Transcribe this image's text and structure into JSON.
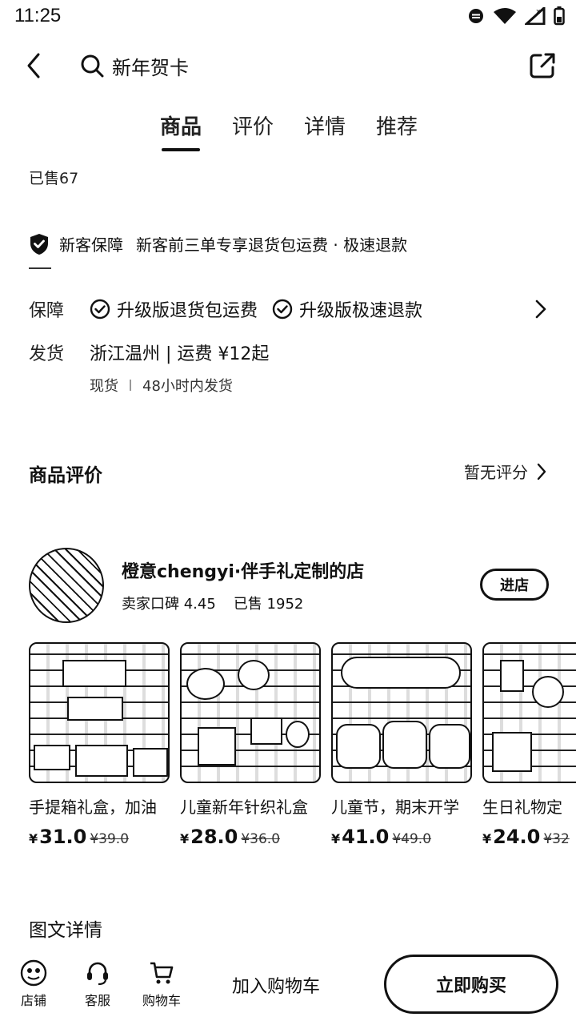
{
  "status": {
    "time": "11:25"
  },
  "header": {
    "search_text": "新年贺卡"
  },
  "tabs": [
    {
      "label": "商品"
    },
    {
      "label": "评价"
    },
    {
      "label": "详情"
    },
    {
      "label": "推荐"
    }
  ],
  "sold": "已售67",
  "guarantee": {
    "title": "新客保障",
    "desc": "新客前三单专享退货包运费 · 极速退款"
  },
  "service": {
    "label": "保障",
    "items": [
      "升级版退货包运费",
      "升级版极速退款"
    ]
  },
  "shipping": {
    "label": "发货",
    "text": "浙江温州 | 运费 ¥12起",
    "stock": "现货",
    "time": "48小时内发货"
  },
  "reviews": {
    "title": "商品评价",
    "status": "暂无评分"
  },
  "store": {
    "name": "橙意chengyi·伴手礼定制的店",
    "rating": "卖家口碑 4.45",
    "sold": "已售 1952",
    "enter": "进店"
  },
  "products": [
    {
      "name": "手提箱礼盒，加油",
      "yen": "¥",
      "price": "31.0",
      "old_price": "¥39.0"
    },
    {
      "name": "儿童新年针织礼盒",
      "yen": "¥",
      "price": "28.0",
      "old_price": "¥36.0"
    },
    {
      "name": "儿童节，期末开学",
      "yen": "¥",
      "price": "41.0",
      "old_price": "¥49.0"
    },
    {
      "name": "生日礼物定",
      "yen": "¥",
      "price": "24.0",
      "old_price": "¥32"
    }
  ],
  "detail_title": "图文详情",
  "bottom": {
    "shop": "店铺",
    "service": "客服",
    "cart": "购物车",
    "add_cart": "加入购物车",
    "buy_now": "立即购买"
  }
}
